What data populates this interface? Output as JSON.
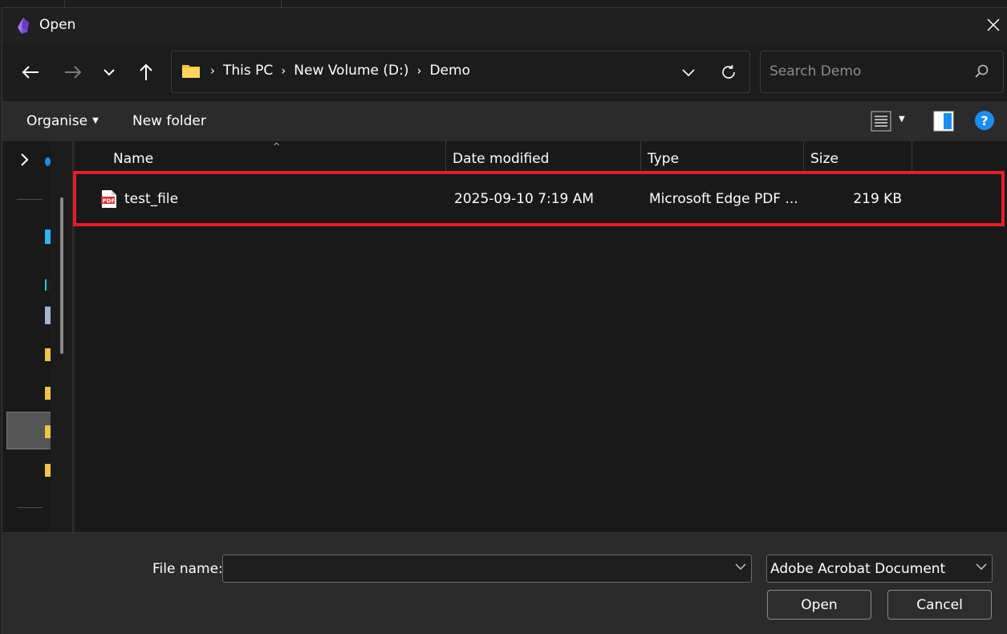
{
  "window": {
    "title": "Open",
    "accent": "#e81c23"
  },
  "nav": {
    "breadcrumbs": [
      "This PC",
      "New Volume (D:)",
      "Demo"
    ]
  },
  "search": {
    "placeholder": "Search Demo"
  },
  "toolbar": {
    "organise_label": "Organise",
    "new_folder_label": "New folder"
  },
  "columns": {
    "name": "Name",
    "date": "Date modified",
    "type": "Type",
    "size": "Size"
  },
  "files": [
    {
      "name": "test_file",
      "date": "2025-09-10 7:19 AM",
      "type": "Microsoft Edge PDF ...",
      "size": "219 KB",
      "icon": "pdf-icon"
    }
  ],
  "footer": {
    "file_name_label": "File name:",
    "file_name_value": "",
    "file_type": "Adobe Acrobat Document",
    "open_label": "Open",
    "cancel_label": "Cancel"
  },
  "icons": {
    "help": "?"
  }
}
